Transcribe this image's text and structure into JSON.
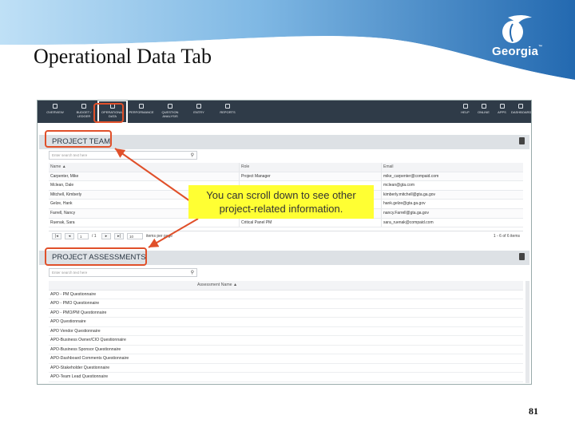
{
  "slide": {
    "title": "Operational Data Tab",
    "logo_text": "Georgia",
    "page_number": "81"
  },
  "nav": {
    "left": [
      {
        "label": "OVERVIEW",
        "icon": "refresh-icon"
      },
      {
        "label": "BUDGET / LEDGER",
        "icon": "ledger-icon"
      },
      {
        "label": "OPERATIONAL DATA",
        "icon": "operational-data-icon",
        "active": true
      },
      {
        "label": "PERFORMANCE",
        "icon": "bar-chart-icon"
      },
      {
        "label": "QUESTION ANALYSIS",
        "icon": "question-icon"
      },
      {
        "label": "ENTRY",
        "icon": "entry-icon"
      },
      {
        "label": "REPORTS",
        "icon": "reports-icon"
      }
    ],
    "right": [
      {
        "label": "HELP",
        "icon": "help-icon"
      },
      {
        "label": "ONLINE",
        "icon": "globe-icon"
      },
      {
        "label": "APPS",
        "icon": "apps-icon"
      },
      {
        "label": "DASHBOARD",
        "icon": "user-icon"
      }
    ]
  },
  "project_team": {
    "title": "PROJECT TEAM",
    "search_placeholder": "Enter search text here",
    "columns": [
      "Name ▲",
      "Role",
      "Email"
    ],
    "rows": [
      [
        "Carpenter, Mike",
        "Project Manager",
        "mike_carpenter@compaid.com"
      ],
      [
        "Mclean, Dale",
        "",
        "mclean@gta.com"
      ],
      [
        "Mitchell, Kimberly",
        "",
        "kimberly.mitchell@gta.ga.gov"
      ],
      [
        "Gelze, Hank",
        "",
        "hank.gelze@gta.ga.gov"
      ],
      [
        "Farrell, Nancy",
        "",
        "nancy.Farrell@gta.ga.gov"
      ],
      [
        "Ruenak, Sara",
        "Critical Panel PM",
        "sara_ruenak@compaid.com"
      ]
    ],
    "pager": {
      "page": "1",
      "of_text": "/ 1",
      "page_size": "10",
      "per_page_text": "items per page",
      "summary": "1 - 6 of 6 items"
    }
  },
  "project_assessments": {
    "title": "PROJECT ASSESSMENTS",
    "search_placeholder": "Enter search text here",
    "column": "Assessment Name ▲",
    "rows": [
      "APO - PM Questionnaire",
      "APO - PMO Questionnaire",
      "APO - PMO/PM Questionnaire",
      "APO Questionnaire",
      "APO Vendor Questionnaire",
      "APO-Business Owner/CIO Questionnaire",
      "APO-Business Sponsor Questionnaire",
      "APO-Dashboard Comments Questionnaire",
      "APO-Stakeholder Questionnaire",
      "APO-Team Lead Questionnaire"
    ]
  },
  "callout": {
    "text": "You can scroll down to see other project-related information."
  },
  "colors": {
    "header_blue": "#2a78c2",
    "highlight": "#e0502a",
    "callout_bg": "#ffff33"
  }
}
